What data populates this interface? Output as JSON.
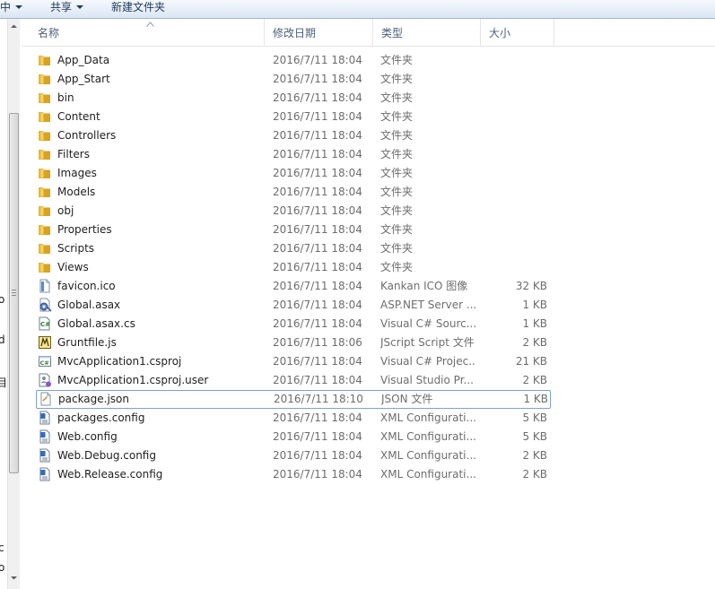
{
  "toolbar": {
    "items": [
      {
        "label": "中",
        "dropdown": true
      },
      {
        "label": "共享",
        "dropdown": true
      },
      {
        "label": "新建文件夹",
        "dropdown": false
      }
    ]
  },
  "nav_fragments": [
    "o",
    "d",
    "目",
    "c",
    "o"
  ],
  "columns": {
    "name": "名称",
    "date": "修改日期",
    "type": "类型",
    "size": "大小"
  },
  "colors": {
    "folder": "#e8b933",
    "selection_border": "#7da2ce",
    "column_header_text": "#4c607a"
  },
  "files": [
    {
      "name": "App_Data",
      "date": "2016/7/11 18:04",
      "type": "文件夹",
      "size": "",
      "icon": "folder-icon"
    },
    {
      "name": "App_Start",
      "date": "2016/7/11 18:04",
      "type": "文件夹",
      "size": "",
      "icon": "folder-icon"
    },
    {
      "name": "bin",
      "date": "2016/7/11 18:04",
      "type": "文件夹",
      "size": "",
      "icon": "folder-icon"
    },
    {
      "name": "Content",
      "date": "2016/7/11 18:04",
      "type": "文件夹",
      "size": "",
      "icon": "folder-icon"
    },
    {
      "name": "Controllers",
      "date": "2016/7/11 18:04",
      "type": "文件夹",
      "size": "",
      "icon": "folder-icon"
    },
    {
      "name": "Filters",
      "date": "2016/7/11 18:04",
      "type": "文件夹",
      "size": "",
      "icon": "folder-icon"
    },
    {
      "name": "Images",
      "date": "2016/7/11 18:04",
      "type": "文件夹",
      "size": "",
      "icon": "folder-icon"
    },
    {
      "name": "Models",
      "date": "2016/7/11 18:04",
      "type": "文件夹",
      "size": "",
      "icon": "folder-icon"
    },
    {
      "name": "obj",
      "date": "2016/7/11 18:04",
      "type": "文件夹",
      "size": "",
      "icon": "folder-icon"
    },
    {
      "name": "Properties",
      "date": "2016/7/11 18:04",
      "type": "文件夹",
      "size": "",
      "icon": "folder-icon"
    },
    {
      "name": "Scripts",
      "date": "2016/7/11 18:04",
      "type": "文件夹",
      "size": "",
      "icon": "folder-icon"
    },
    {
      "name": "Views",
      "date": "2016/7/11 18:04",
      "type": "文件夹",
      "size": "",
      "icon": "folder-icon"
    },
    {
      "name": "favicon.ico",
      "date": "2016/7/11 18:04",
      "type": "Kankan ICO 图像",
      "size": "32 KB",
      "icon": "ico-file-icon"
    },
    {
      "name": "Global.asax",
      "date": "2016/7/11 18:04",
      "type": "ASP.NET Server ...",
      "size": "1 KB",
      "icon": "asax-file-icon"
    },
    {
      "name": "Global.asax.cs",
      "date": "2016/7/11 18:04",
      "type": "Visual C# Sourc...",
      "size": "1 KB",
      "icon": "csharp-file-icon"
    },
    {
      "name": "Gruntfile.js",
      "date": "2016/7/11 18:06",
      "type": "JScript Script 文件",
      "size": "2 KB",
      "icon": "js-file-icon"
    },
    {
      "name": "MvcApplication1.csproj",
      "date": "2016/7/11 18:04",
      "type": "Visual C# Projec...",
      "size": "21 KB",
      "icon": "csproj-file-icon"
    },
    {
      "name": "MvcApplication1.csproj.user",
      "date": "2016/7/11 18:04",
      "type": "Visual Studio Pr...",
      "size": "2 KB",
      "icon": "user-file-icon"
    },
    {
      "name": "package.json",
      "date": "2016/7/11 18:10",
      "type": "JSON 文件",
      "size": "1 KB",
      "icon": "json-file-icon",
      "selected": true
    },
    {
      "name": "packages.config",
      "date": "2016/7/11 18:04",
      "type": "XML Configurati...",
      "size": "5 KB",
      "icon": "config-file-icon"
    },
    {
      "name": "Web.config",
      "date": "2016/7/11 18:04",
      "type": "XML Configurati...",
      "size": "5 KB",
      "icon": "config-file-icon"
    },
    {
      "name": "Web.Debug.config",
      "date": "2016/7/11 18:04",
      "type": "XML Configurati...",
      "size": "2 KB",
      "icon": "config-file-icon"
    },
    {
      "name": "Web.Release.config",
      "date": "2016/7/11 18:04",
      "type": "XML Configurati...",
      "size": "2 KB",
      "icon": "config-file-icon"
    }
  ]
}
